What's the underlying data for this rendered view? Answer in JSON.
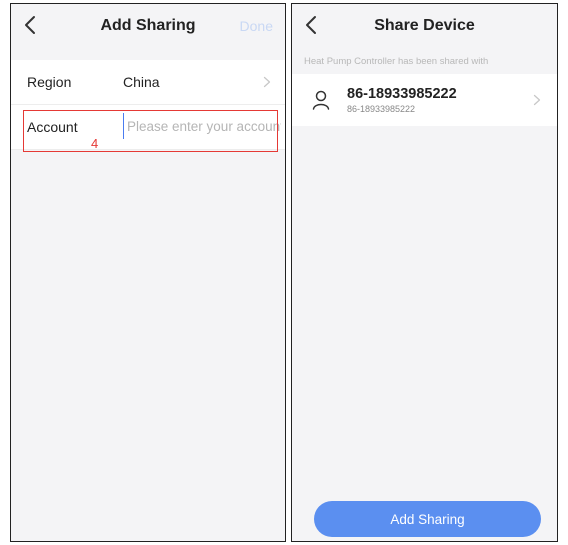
{
  "left_screen": {
    "title": "Add Sharing",
    "done_label": "Done",
    "region": {
      "label": "Region",
      "value": "China"
    },
    "account": {
      "label": "Account",
      "value": "",
      "placeholder": "Please enter your account"
    },
    "annotation_step": "4"
  },
  "right_screen": {
    "title": "Share Device",
    "shared_caption": "Heat Pump Controller has been shared with",
    "shared_users": [
      {
        "name": "86-18933985222",
        "sub": "86-18933985222"
      }
    ],
    "add_button_label": "Add Sharing"
  },
  "colors": {
    "accent": "#5b8ff0",
    "annotation": "#e53935",
    "background": "#f4f4f6",
    "done_disabled": "#c9d8f4"
  },
  "icons": {
    "back": "chevron-left-icon",
    "row_arrow": "chevron-right-icon",
    "user": "user-icon"
  }
}
